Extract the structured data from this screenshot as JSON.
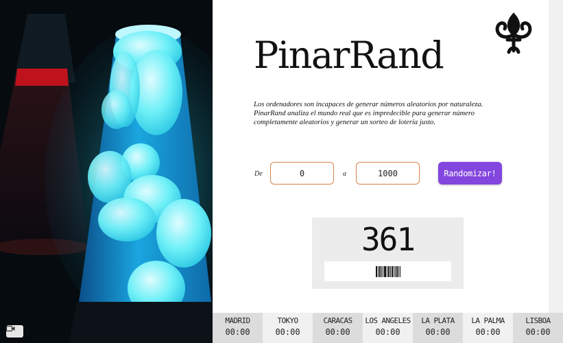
{
  "app": {
    "title": "PinarRand",
    "description": "Los ordenadores son incapaces de generar números aleatorios por naturaleza. PinarRand analiza el mundo real que es impredecible para generar número completamente aleatorios y generar un sorteo de lotería justo."
  },
  "range": {
    "from_label": "De",
    "from_value": "0",
    "to_label": "a",
    "to_value": "1000"
  },
  "randomize_button": {
    "label": "Randomizar!"
  },
  "result": {
    "value": "361"
  },
  "clocks": [
    {
      "city": "MADRID",
      "time": "00:00"
    },
    {
      "city": "TOKYO",
      "time": "00:00"
    },
    {
      "city": "CARACAS",
      "time": "00:00"
    },
    {
      "city": "LOS ANGELES",
      "time": "00:00"
    },
    {
      "city": "LA PLATA",
      "time": "00:00"
    },
    {
      "city": "LA PALMA",
      "time": "00:00"
    },
    {
      "city": "LISBOA",
      "time": "00:00"
    }
  ],
  "icons": {
    "logo": "fleur-de-lis-icon",
    "video": "video-camera-icon",
    "barcode": "barcode-icon"
  },
  "colors": {
    "accent": "#8346de",
    "input_border": "#d7824b",
    "result_card": "#ececec"
  }
}
